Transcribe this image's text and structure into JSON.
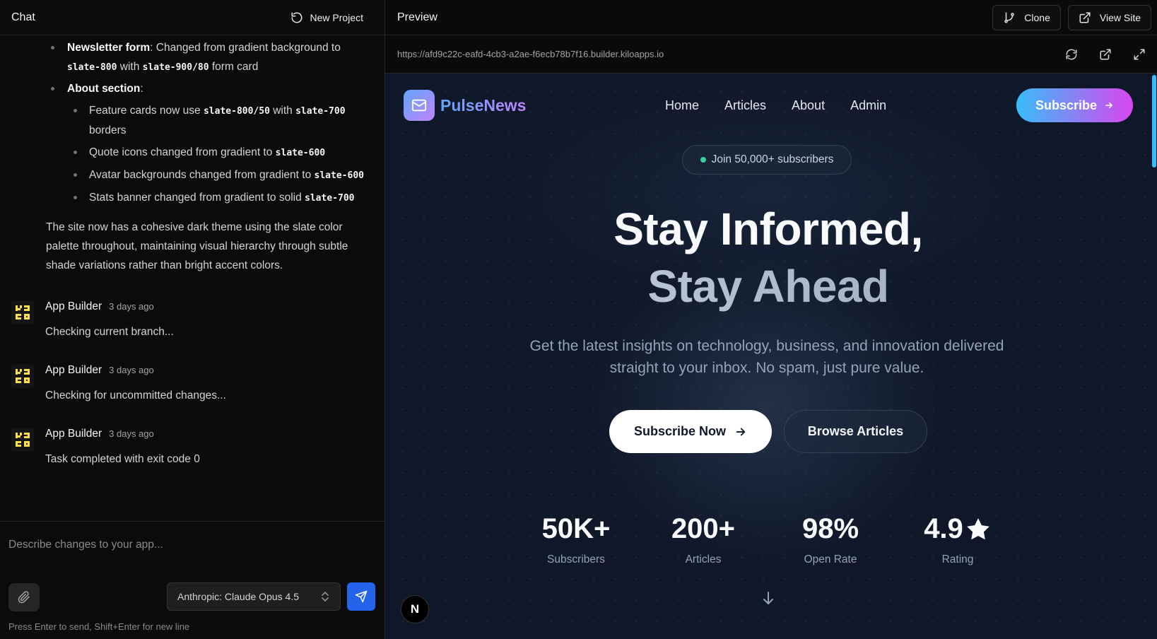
{
  "chat": {
    "title": "Chat",
    "new_project_label": "New Project",
    "bullets": [
      {
        "label": "Newsletter form",
        "text_a": ": Changed from gradient background to ",
        "code_a": "slate-800",
        "text_b": " with ",
        "code_b": "slate-900/80",
        "text_c": " form card"
      },
      {
        "label": "About section",
        "text_a": ":"
      }
    ],
    "sub_bullets": [
      {
        "text_a": "Feature cards now use ",
        "code_a": "slate-800/50",
        "text_b": " with ",
        "code_b": "slate-700",
        "text_c": " borders"
      },
      {
        "text_a": "Quote icons changed from gradient to ",
        "code_a": "slate-600"
      },
      {
        "text_a": "Avatar backgrounds changed from gradient to ",
        "code_a": "slate-600"
      },
      {
        "text_a": "Stats banner changed from gradient to solid ",
        "code_a": "slate-700"
      }
    ],
    "summary": "The site now has a cohesive dark theme using the slate color palette throughout, maintaining visual hierarchy through subtle shade variations rather than bright accent colors.",
    "messages": [
      {
        "author": "App Builder",
        "time": "3 days ago",
        "text": "Checking current branch..."
      },
      {
        "author": "App Builder",
        "time": "3 days ago",
        "text": "Checking for uncommitted changes..."
      },
      {
        "author": "App Builder",
        "time": "3 days ago",
        "text": "Task completed with exit code 0"
      }
    ],
    "composer": {
      "placeholder": "Describe changes to your app...",
      "model": "Anthropic: Claude Opus 4.5",
      "hint": "Press Enter to send, Shift+Enter for new line"
    }
  },
  "preview": {
    "title": "Preview",
    "clone_label": "Clone",
    "view_site_label": "View Site",
    "url": "https://afd9c22c-eafd-4cb3-a2ae-f6ecb78b7f16.builder.kiloapps.io"
  },
  "site": {
    "brand": "PulseNews",
    "nav": [
      "Home",
      "Articles",
      "About",
      "Admin"
    ],
    "subscribe_label": "Subscribe",
    "badge": "Join 50,000+ subscribers",
    "hero_line1": "Stay Informed,",
    "hero_line2": "Stay Ahead",
    "subtitle": "Get the latest insights on technology, business, and innovation delivered straight to your inbox. No spam, just pure value.",
    "cta_primary": "Subscribe Now",
    "cta_secondary": "Browse Articles",
    "stats": [
      {
        "value": "50K+",
        "label": "Subscribers"
      },
      {
        "value": "200+",
        "label": "Articles"
      },
      {
        "value": "98%",
        "label": "Open Rate"
      },
      {
        "value": "4.9",
        "label": "Rating"
      }
    ],
    "next_badge": "N"
  },
  "colors": {
    "accent_blue": "#2563eb",
    "brand_gradient_start": "#60a5fa",
    "brand_gradient_end": "#c084fc",
    "status_green": "#34d399"
  }
}
